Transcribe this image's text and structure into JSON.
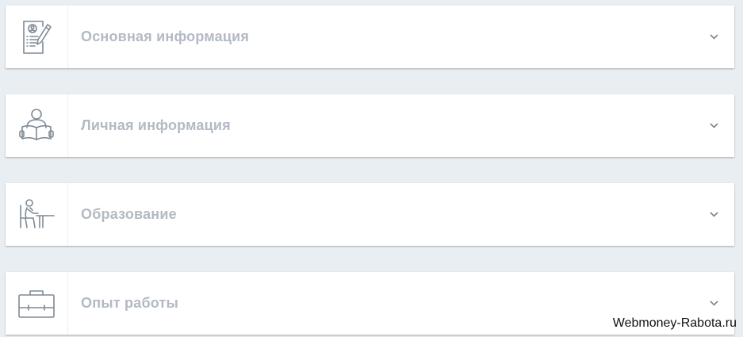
{
  "sections": [
    {
      "title": "Основная информация",
      "icon": "resume-edit-icon"
    },
    {
      "title": "Личная информация",
      "icon": "person-reading-icon"
    },
    {
      "title": "Образование",
      "icon": "student-desk-icon"
    },
    {
      "title": "Опыт работы",
      "icon": "briefcase-icon"
    }
  ],
  "watermark": "Webmoney-Rabota.ru",
  "colors": {
    "background": "#e9eef2",
    "panel": "#ffffff",
    "title": "#b3bac3",
    "icon": "#7f8a95"
  }
}
